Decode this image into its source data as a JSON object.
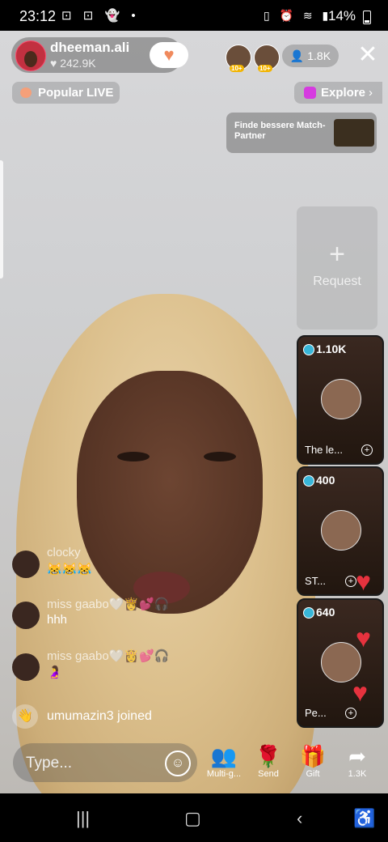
{
  "status_bar": {
    "time": "23:12",
    "battery": "14%"
  },
  "host": {
    "name": "dheeman.ali",
    "likes": "242.9K"
  },
  "viewers": {
    "count": "1.8K",
    "level_a": "10+",
    "level_b": "10+"
  },
  "tags": {
    "popular_label": "Popular LIVE",
    "explore_label": "Explore"
  },
  "promo": {
    "text": "Finde bessere Match-Partner"
  },
  "request": {
    "label": "Request"
  },
  "guests": [
    {
      "score": "1.10K",
      "name": "The le..."
    },
    {
      "score": "400",
      "name": "ST..."
    },
    {
      "score": "640",
      "name": "Pe..."
    }
  ],
  "comments": [
    {
      "user": "clocky",
      "message": "😹😹😹"
    },
    {
      "user": "miss gaabo🤍👸💕🎧",
      "message": "hhh"
    },
    {
      "user": "miss gaabo🤍👸💕🎧",
      "message": "🤰"
    }
  ],
  "joined": {
    "user": "umumazin3",
    "suffix": "joined"
  },
  "input": {
    "placeholder": "Type..."
  },
  "actions": {
    "multi_guest": "Multi-g...",
    "send": "Send",
    "gift": "Gift",
    "share": "1.3K"
  },
  "colors": {
    "accent_red": "#e6323e",
    "gem_blue": "#38b6d8",
    "follow_orange": "#f08a5d"
  }
}
